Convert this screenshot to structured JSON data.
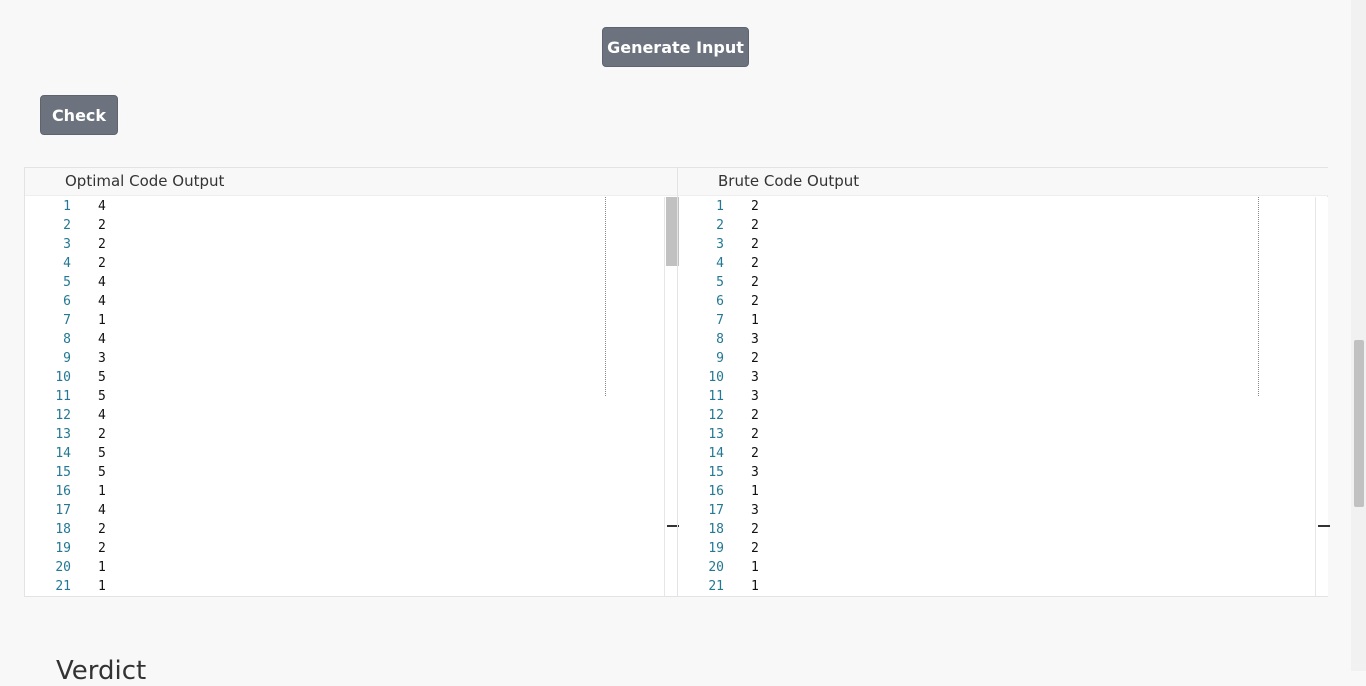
{
  "buttons": {
    "generate_input": "Generate Input",
    "check": "Check"
  },
  "optimal": {
    "title": "Optimal Code Output",
    "lines": [
      "4",
      "2",
      "2",
      "2",
      "4",
      "4",
      "1",
      "4",
      "3",
      "5",
      "5",
      "4",
      "2",
      "5",
      "5",
      "1",
      "4",
      "2",
      "2",
      "1",
      "1"
    ]
  },
  "brute": {
    "title": "Brute Code Output",
    "lines": [
      "2",
      "2",
      "2",
      "2",
      "2",
      "2",
      "1",
      "3",
      "2",
      "3",
      "3",
      "2",
      "2",
      "2",
      "3",
      "1",
      "3",
      "2",
      "2",
      "1",
      "1"
    ]
  },
  "verdict": {
    "title": "Verdict"
  },
  "colors": {
    "button_bg": "#6c737e",
    "line_number": "#237893",
    "page_bg": "#f8f8f9"
  }
}
